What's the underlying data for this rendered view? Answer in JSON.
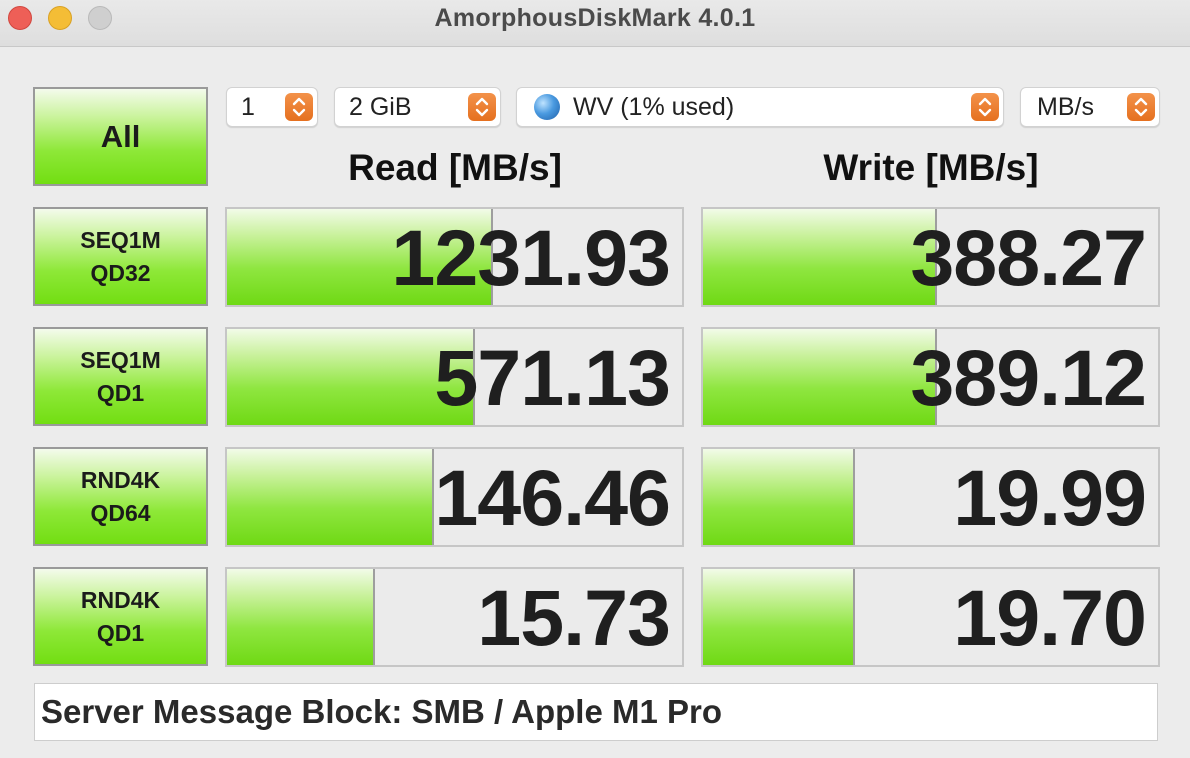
{
  "window": {
    "title": "AmorphousDiskMark 4.0.1"
  },
  "controls": {
    "all_label": "All",
    "count": "1",
    "size": "2 GiB",
    "target": "WV (1% used)",
    "unit": "MB/s"
  },
  "headers": {
    "read": "Read [MB/s]",
    "write": "Write [MB/s]"
  },
  "tests": [
    {
      "line1": "SEQ1M",
      "line2": "QD32",
      "read": "1231.93",
      "write": "388.27",
      "read_fill": 0.58,
      "write_fill": 0.51
    },
    {
      "line1": "SEQ1M",
      "line2": "QD1",
      "read": "571.13",
      "write": "389.12",
      "read_fill": 0.54,
      "write_fill": 0.51
    },
    {
      "line1": "RND4K",
      "line2": "QD64",
      "read": "146.46",
      "write": "19.99",
      "read_fill": 0.45,
      "write_fill": 0.33
    },
    {
      "line1": "RND4K",
      "line2": "QD1",
      "read": "15.73",
      "write": "19.70",
      "read_fill": 0.32,
      "write_fill": 0.33
    }
  ],
  "comment": "Server Message Block: SMB / Apple M1 Pro",
  "colors": {
    "accent_orange": "#e9762a",
    "bar_green": "#7fe22a",
    "close": "#ee5f57",
    "minimize": "#f4bd36"
  }
}
